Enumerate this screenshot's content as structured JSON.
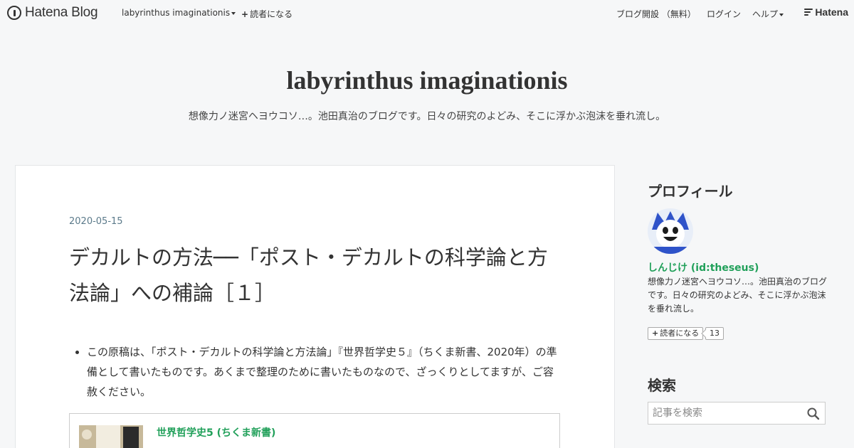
{
  "topbar": {
    "logo_text": "Hatena Blog",
    "blog_menu": "labyrinthus imaginationis",
    "subscribe": "読者になる",
    "open_blog": "ブログ開設 （無料）",
    "login": "ログイン",
    "help": "ヘルプ",
    "hatena": "Hatena"
  },
  "header": {
    "title": "labyrinthus imaginationis",
    "description": "想像力ノ迷宮ヘヨウコソ…。池田真治のブログです。日々の研究のよどみ、そこに浮かぶ泡沫を垂れ流し。"
  },
  "entry": {
    "date": "2020-05-15",
    "title": "デカルトの方法──「ポスト・デカルトの科学論と方法論」への補論［１］",
    "bullets": [
      "この原稿は、「ポスト・デカルトの科学論と方法論」『世界哲学史５』（ちくま新書、2020年）の準備として書いたものです。あくまで整理のために書いたものなので、ざっくりとしてますが、ご容赦ください。"
    ],
    "book_title": "世界哲学史5 (ちくま新書)"
  },
  "sidebar": {
    "profile_heading": "プロフィール",
    "profile_name": "しんじけ (id:theseus)",
    "profile_desc": "想像力ノ迷宮ヘヨウコソ…。池田真治のブログです。日々の研究のよどみ、そこに浮かぶ泡沫を垂れ流し。",
    "reader_button": "読者になる",
    "reader_count": "13",
    "search_heading": "検索",
    "search_placeholder": "記事を検索"
  },
  "colors": {
    "link_green": "#21a05a",
    "date_blue": "#5b7a8a",
    "background": "#f6f7f8"
  }
}
